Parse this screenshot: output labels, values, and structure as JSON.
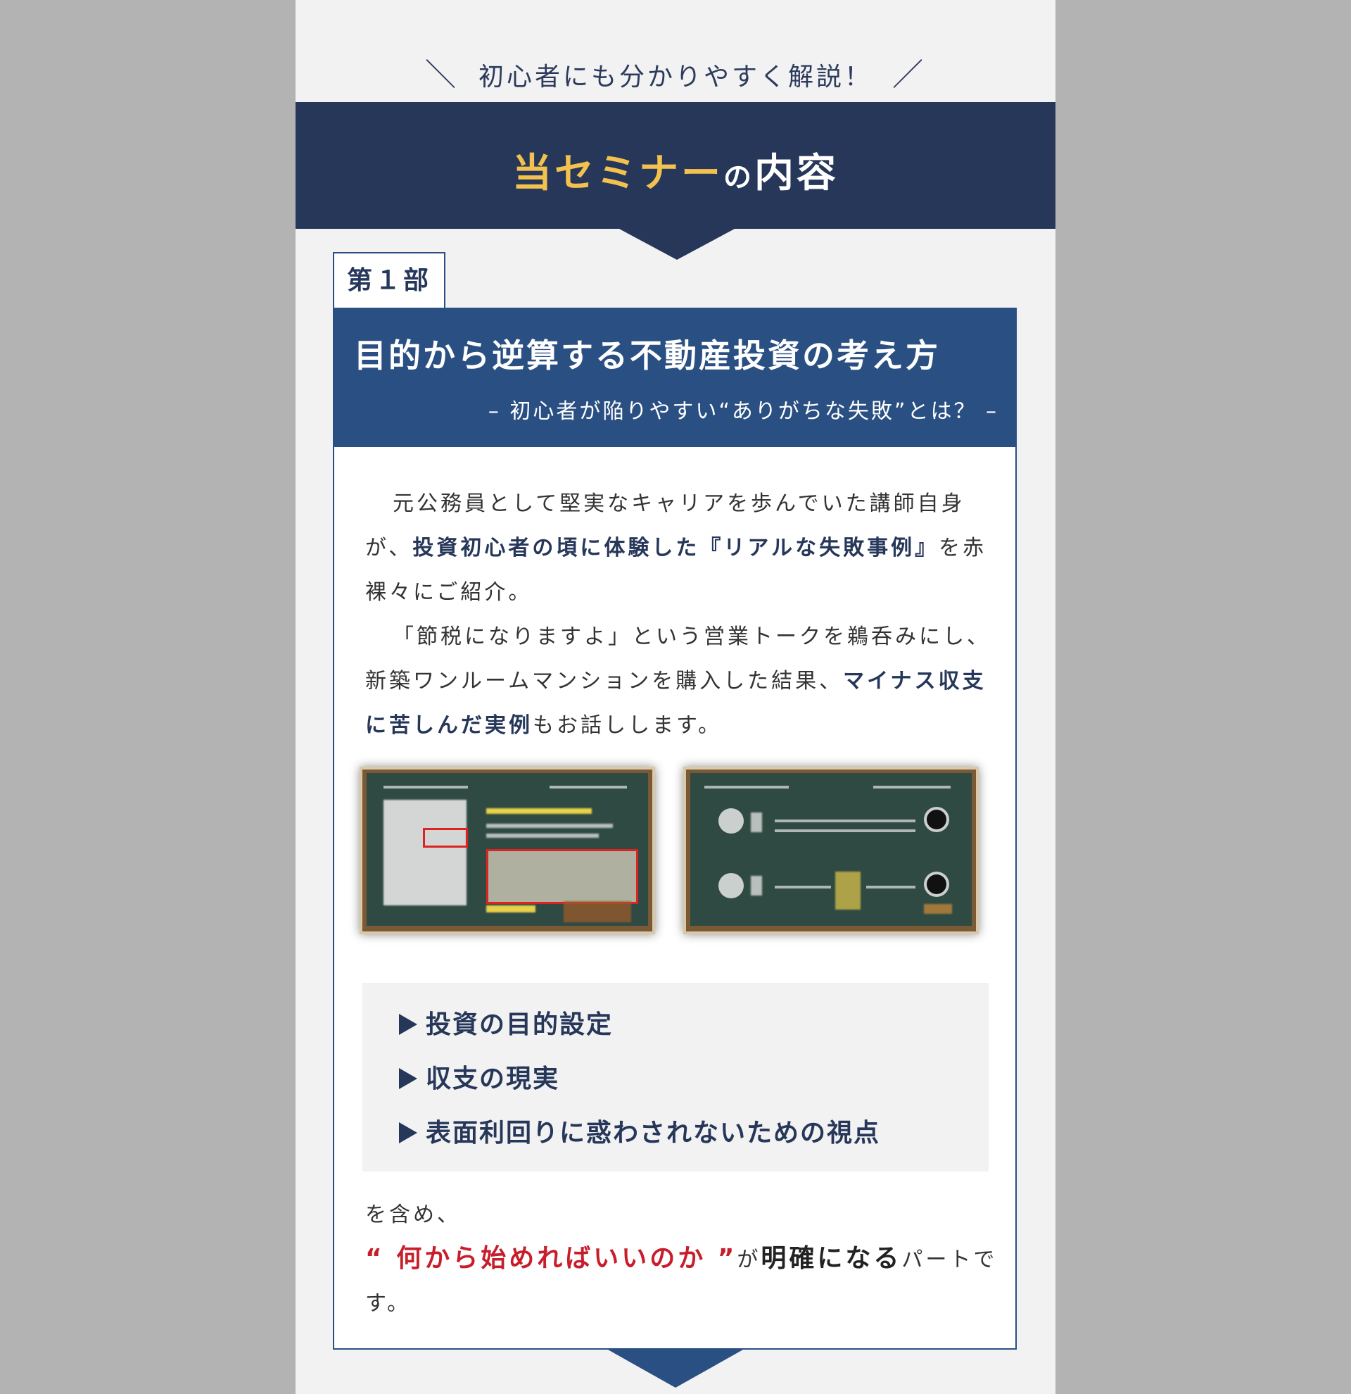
{
  "tagline": {
    "left_slash": "＼",
    "text": "初心者にも分かりやすく解説！",
    "right_slash": "／"
  },
  "header": {
    "title_highlight": "当セミナー",
    "title_particle": "の",
    "title_rest": "内容"
  },
  "part": {
    "label": "第１部",
    "heading": "目的から逆算する不動産投資の考え方",
    "subheading": "– 初心者が陥りやすい“ありがちな失敗”とは？ –"
  },
  "body": {
    "p1_a": "元公務員として堅実なキャリアを歩んでいた講師自身が、",
    "p1_em": "投資初心者の頃に体験した『リアルな失敗事例』",
    "p1_b": "を赤裸々にご紹介。",
    "p2_a": "「節税になりますよ」という営業トークを鵜呑みにし、新築ワンルームマンションを購入した結果、",
    "p2_em": "マイナス収支に苦しんだ実例",
    "p2_b": "もお話しします。"
  },
  "checklist": [
    {
      "label": "投資の目的設定"
    },
    {
      "label": "収支の現実"
    },
    {
      "label": "表面利回りに惑わされないための視点"
    }
  ],
  "closing": {
    "lead": "を含め、",
    "quote": "“ 何から始めればいいのか ”",
    "particle": "が",
    "bold": "明確になる",
    "tail": "パートです。"
  },
  "colors": {
    "navy": "#26375a",
    "blue": "#2a4f82",
    "gold": "#f2c14e",
    "red": "#c81e2b"
  }
}
